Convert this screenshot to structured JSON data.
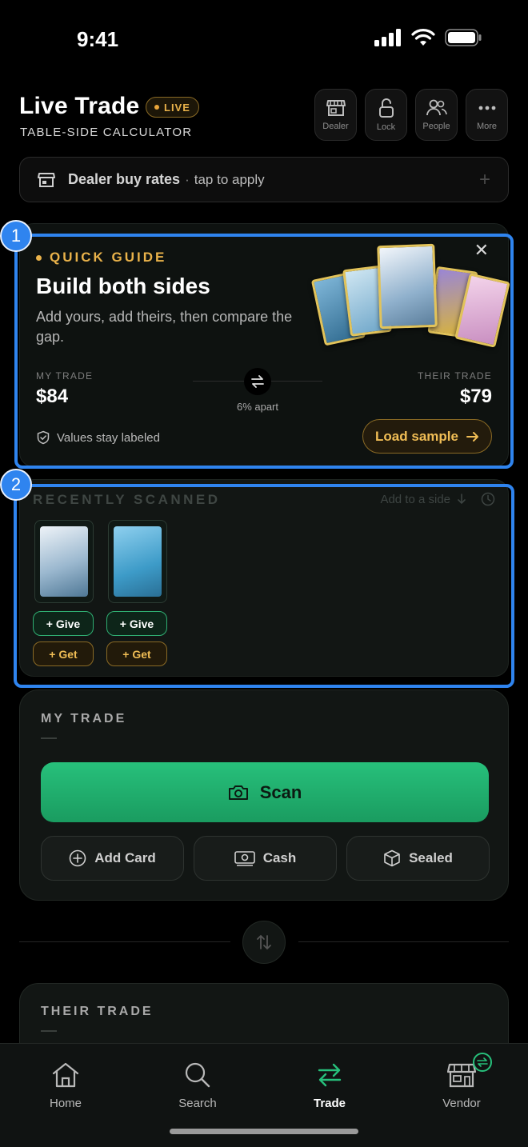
{
  "status": {
    "time": "9:41"
  },
  "header": {
    "title": "Live Trade",
    "badge": "LIVE",
    "subtitle": "TABLE-SIDE CALCULATOR",
    "buttons": [
      {
        "label": "Dealer",
        "icon": "storefront-icon"
      },
      {
        "label": "Lock",
        "icon": "lock-open-icon"
      },
      {
        "label": "People",
        "icon": "people-icon"
      },
      {
        "label": "More",
        "icon": "more-dots-icon"
      }
    ]
  },
  "dealer_bar": {
    "label": "Dealer buy rates",
    "separator": "·",
    "hint": "tap to apply",
    "action": "+"
  },
  "guide": {
    "tag": "QUICK GUIDE",
    "title": "Build both sides",
    "description": "Add yours, add theirs, then compare the gap.",
    "my_label": "MY TRADE",
    "my_value": "$84",
    "their_label": "THEIR TRADE",
    "their_value": "$79",
    "gap": "6% apart",
    "values_note": "Values stay labeled",
    "load_button": "Load sample",
    "close": "✕"
  },
  "recent": {
    "title": "RECENTLY SCANNED",
    "add_hint": "Add to a side",
    "items": [
      {
        "give": "+ Give",
        "get": "+ Get"
      },
      {
        "give": "+ Give",
        "get": "+ Get"
      }
    ]
  },
  "my_trade": {
    "title": "MY TRADE",
    "scan": "Scan",
    "actions": [
      {
        "label": "Add Card",
        "icon": "plus-circle-icon"
      },
      {
        "label": "Cash",
        "icon": "cash-icon"
      },
      {
        "label": "Sealed",
        "icon": "box-icon"
      }
    ]
  },
  "their_trade": {
    "title": "THEIR TRADE"
  },
  "annotations": [
    "1",
    "2"
  ],
  "tabs": [
    {
      "label": "Home",
      "icon": "home-icon",
      "active": false
    },
    {
      "label": "Search",
      "icon": "search-icon",
      "active": false
    },
    {
      "label": "Trade",
      "icon": "trade-swap-icon",
      "active": true
    },
    {
      "label": "Vendor",
      "icon": "vendor-storefront-icon",
      "active": false
    }
  ],
  "colors": {
    "accent_green": "#27c07b",
    "accent_gold": "#e9b24a",
    "highlight_blue": "#2f84ef"
  }
}
